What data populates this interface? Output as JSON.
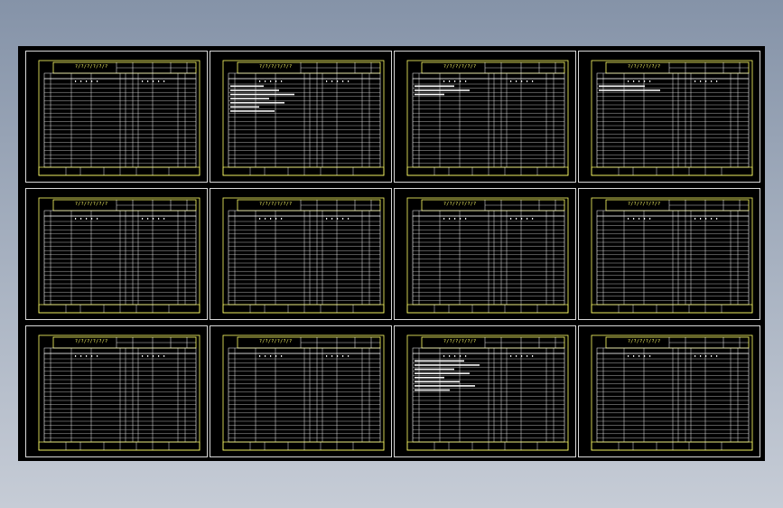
{
  "drawing": {
    "sheets": [
      {
        "id": 1,
        "title": "?/?/?/?/?/?",
        "notes": 0
      },
      {
        "id": 2,
        "title": "?/?/?/?/?/?",
        "notes": 7
      },
      {
        "id": 3,
        "title": "?/?/?/?/?/?",
        "notes": 3
      },
      {
        "id": 4,
        "title": "?/?/?/?/?/?",
        "notes": 2
      },
      {
        "id": 5,
        "title": "?/?/?/?/?/?",
        "notes": 0
      },
      {
        "id": 6,
        "title": "?/?/?/?/?/?",
        "notes": 0
      },
      {
        "id": 7,
        "title": "?/?/?/?/?/?",
        "notes": 0
      },
      {
        "id": 8,
        "title": "?/?/?/?/?/?",
        "notes": 0
      },
      {
        "id": 9,
        "title": "?/?/?/?/?/?",
        "notes": 0
      },
      {
        "id": 10,
        "title": "?/?/?/?/?/?",
        "notes": 0
      },
      {
        "id": 11,
        "title": "?/?/?/?/?/?",
        "notes": 8
      },
      {
        "id": 12,
        "title": "?/?/?/?/?/?",
        "notes": 0
      }
    ],
    "colors": {
      "background": "#000000",
      "frame": "#d8d8d8",
      "grid": "#ffffff",
      "title_border": "#ffff66"
    }
  }
}
